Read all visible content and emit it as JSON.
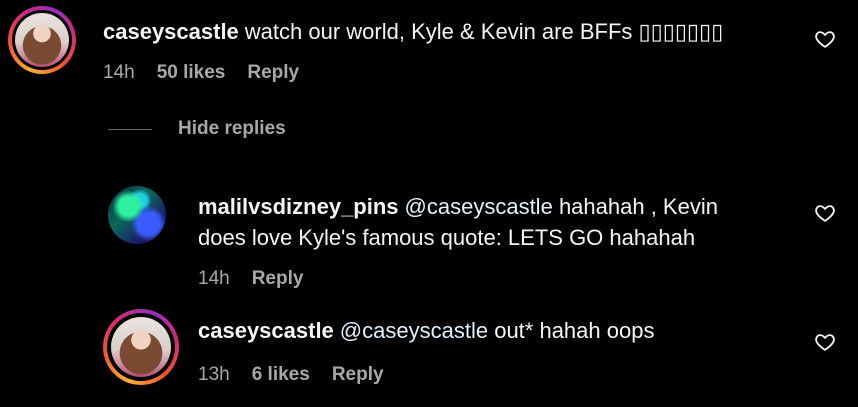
{
  "comments": [
    {
      "username": "caseyscastle",
      "text": "watch our world, Kyle & Kevin are BFFs ▯▯▯▯▯▯▯",
      "time": "14h",
      "likes": "50 likes",
      "reply": "Reply",
      "avatar_icon": "profile-photo-casey",
      "has_story_ring": true
    }
  ],
  "hide_replies": {
    "label": "Hide replies"
  },
  "replies": [
    {
      "username": "malilvsdizney_pins",
      "mention": "@caseyscastle",
      "text_line1": "hahahah , Kevin",
      "text_line2": "does love Kyle's famous quote: LETS GO hahahah",
      "time": "14h",
      "reply": "Reply",
      "avatar_icon": "profile-photo-mali",
      "has_story_ring": false
    },
    {
      "username": "caseyscastle",
      "mention": "@caseyscastle",
      "text": "out* hahah oops",
      "time": "13h",
      "likes": "6 likes",
      "reply": "Reply",
      "avatar_icon": "profile-photo-casey",
      "has_story_ring": true
    }
  ],
  "icons": {
    "like": "heart-outline-icon"
  },
  "colors": {
    "background": "#000000",
    "text": "#f5f5f5",
    "secondary": "#a8a8a8",
    "mention": "#e0f1ff"
  }
}
